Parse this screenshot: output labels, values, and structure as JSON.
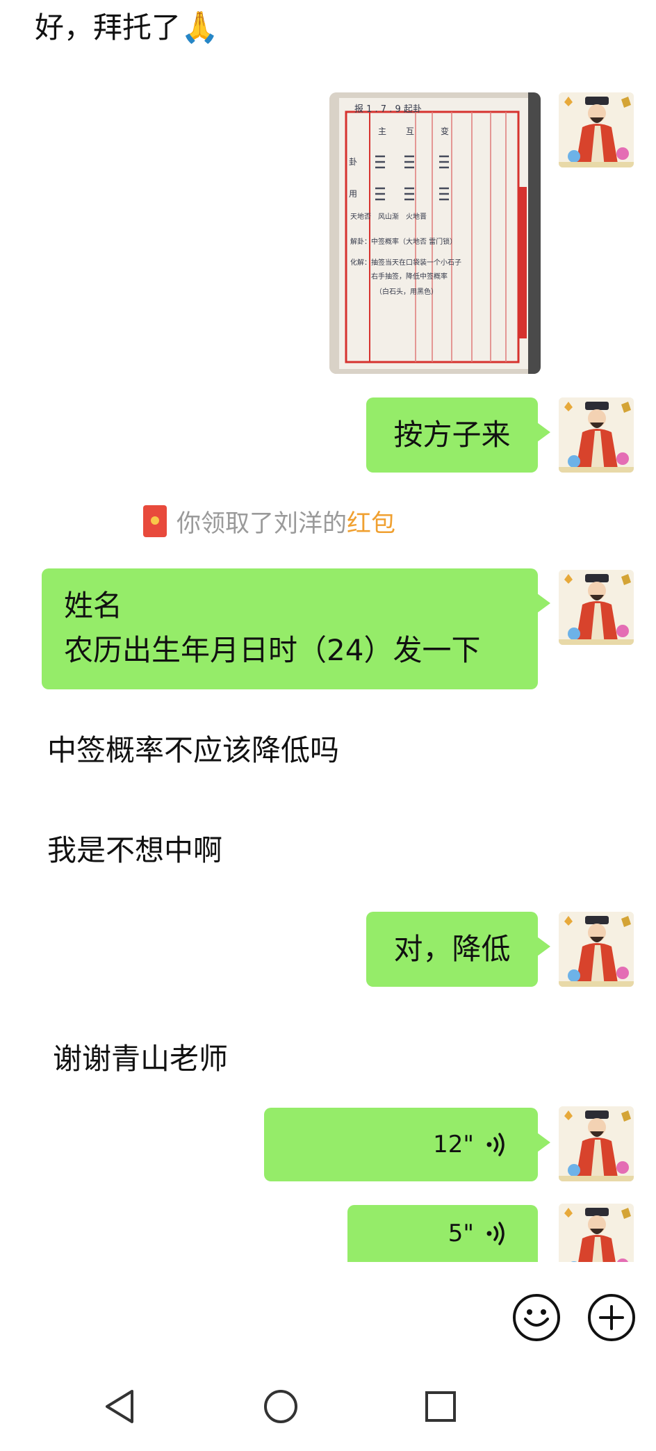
{
  "messages": {
    "top_text": "好，拜托了",
    "top_emoji": "🙏",
    "prescribe": "按方子来",
    "system_prefix": "你领取了刘洋的",
    "system_link": "红包",
    "request_line1": "姓名",
    "request_line2": "农历出生年月日时（24）发一下",
    "question1": "中签概率不应该降低吗",
    "question2": "我是不想中啊",
    "reply_lower": "对，降低",
    "thanks": "谢谢青山老师",
    "voice1_duration": "12\"",
    "voice2_duration": "5\""
  },
  "photo_note": {
    "header": "报 1 . 7 . 9 起卦",
    "col_headers": [
      "主",
      "互",
      "变"
    ],
    "row_labels": [
      "卦",
      "用"
    ],
    "line_tianxiang": "天地否　风山渐　火地晋",
    "line_jiegua": "解卦：中签概率（大地否 雷门锁）",
    "line_huajie1": "化解：抽签当天在口袋装一个小石子",
    "line_huajie2": "右手抽签，降低中签概率",
    "line_huajie3": "（白石头，用黑色）"
  },
  "colors": {
    "bubble_green": "#95ec69",
    "system_text": "#9a9a9a",
    "redpacket_link": "#f0a030",
    "redpacket_icon": "#e84a3c"
  },
  "icons": [
    "emoji-icon",
    "plus-icon",
    "back-icon",
    "home-icon",
    "recents-icon",
    "voice-wave-icon",
    "red-packet-icon"
  ]
}
